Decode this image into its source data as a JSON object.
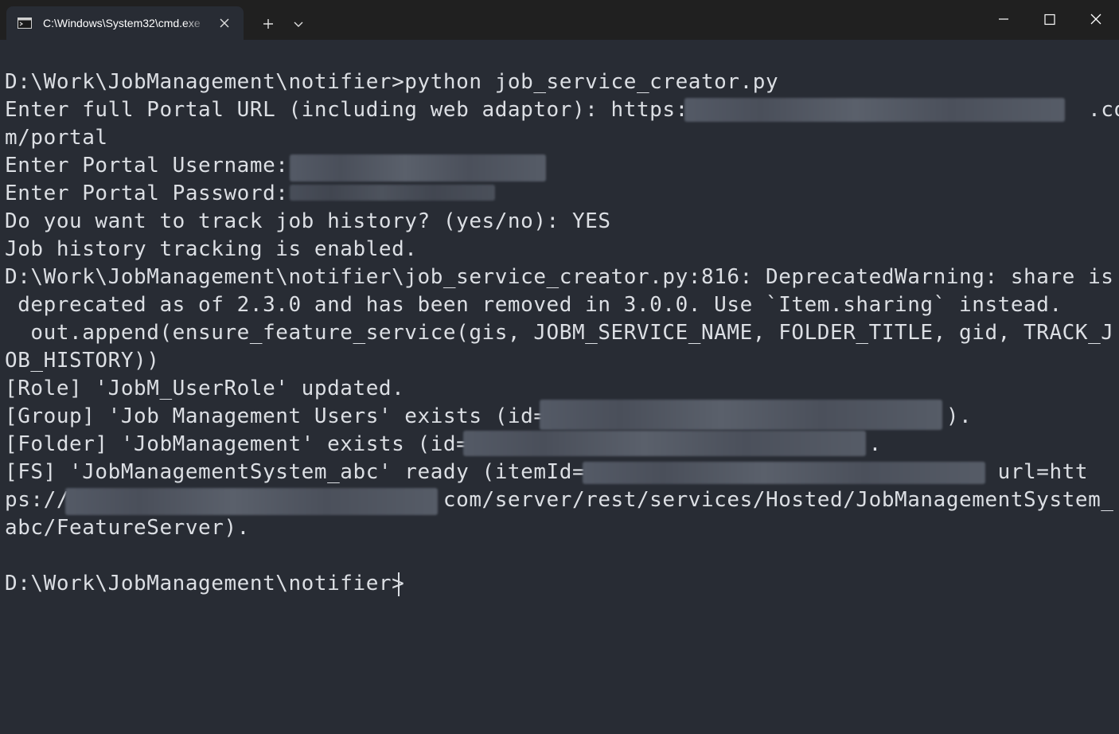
{
  "window": {
    "tab_title": "C:\\Windows\\System32\\cmd.exe",
    "tab_icon": "console-icon",
    "new_tab_icon": "plus-icon",
    "dropdown_icon": "chevron-down-icon",
    "controls": [
      "minimize-icon",
      "maximize-icon",
      "close-icon"
    ]
  },
  "terminal": {
    "lines": [
      "D:\\Work\\JobManagement\\notifier>python job_service_creator.py",
      "Enter full Portal URL (including web adaptor): https:/                              .co",
      "m/portal",
      "Enter Portal Username: ",
      "Enter Portal Password: ",
      "Do you want to track job history? (yes/no): YES",
      "Job history tracking is enabled.",
      "D:\\Work\\JobManagement\\notifier\\job_service_creator.py:816: DeprecatedWarning: share is",
      " deprecated as of 2.3.0 and has been removed in 3.0.0. Use `Item.sharing` instead.",
      "  out.append(ensure_feature_service(gis, JOBM_SERVICE_NAME, FOLDER_TITLE, gid, TRACK_J",
      "OB_HISTORY))",
      "[Role] 'JobM_UserRole' updated.",
      "[Group] 'Job Management Users' exists (id=                               ).",
      "[Folder] 'JobManagement' exists (id=                              ).",
      "[FS] 'JobManagementSystem_abc' ready (itemId=                              , url=htt",
      "ps://                             com/server/rest/services/Hosted/JobManagementSystem_",
      "abc/FeatureServer).",
      "",
      "D:\\Work\\JobManagement\\notifier>"
    ]
  },
  "colors": {
    "background": "#282c34",
    "titlebar": "#202020",
    "text": "#dcdfe4"
  }
}
